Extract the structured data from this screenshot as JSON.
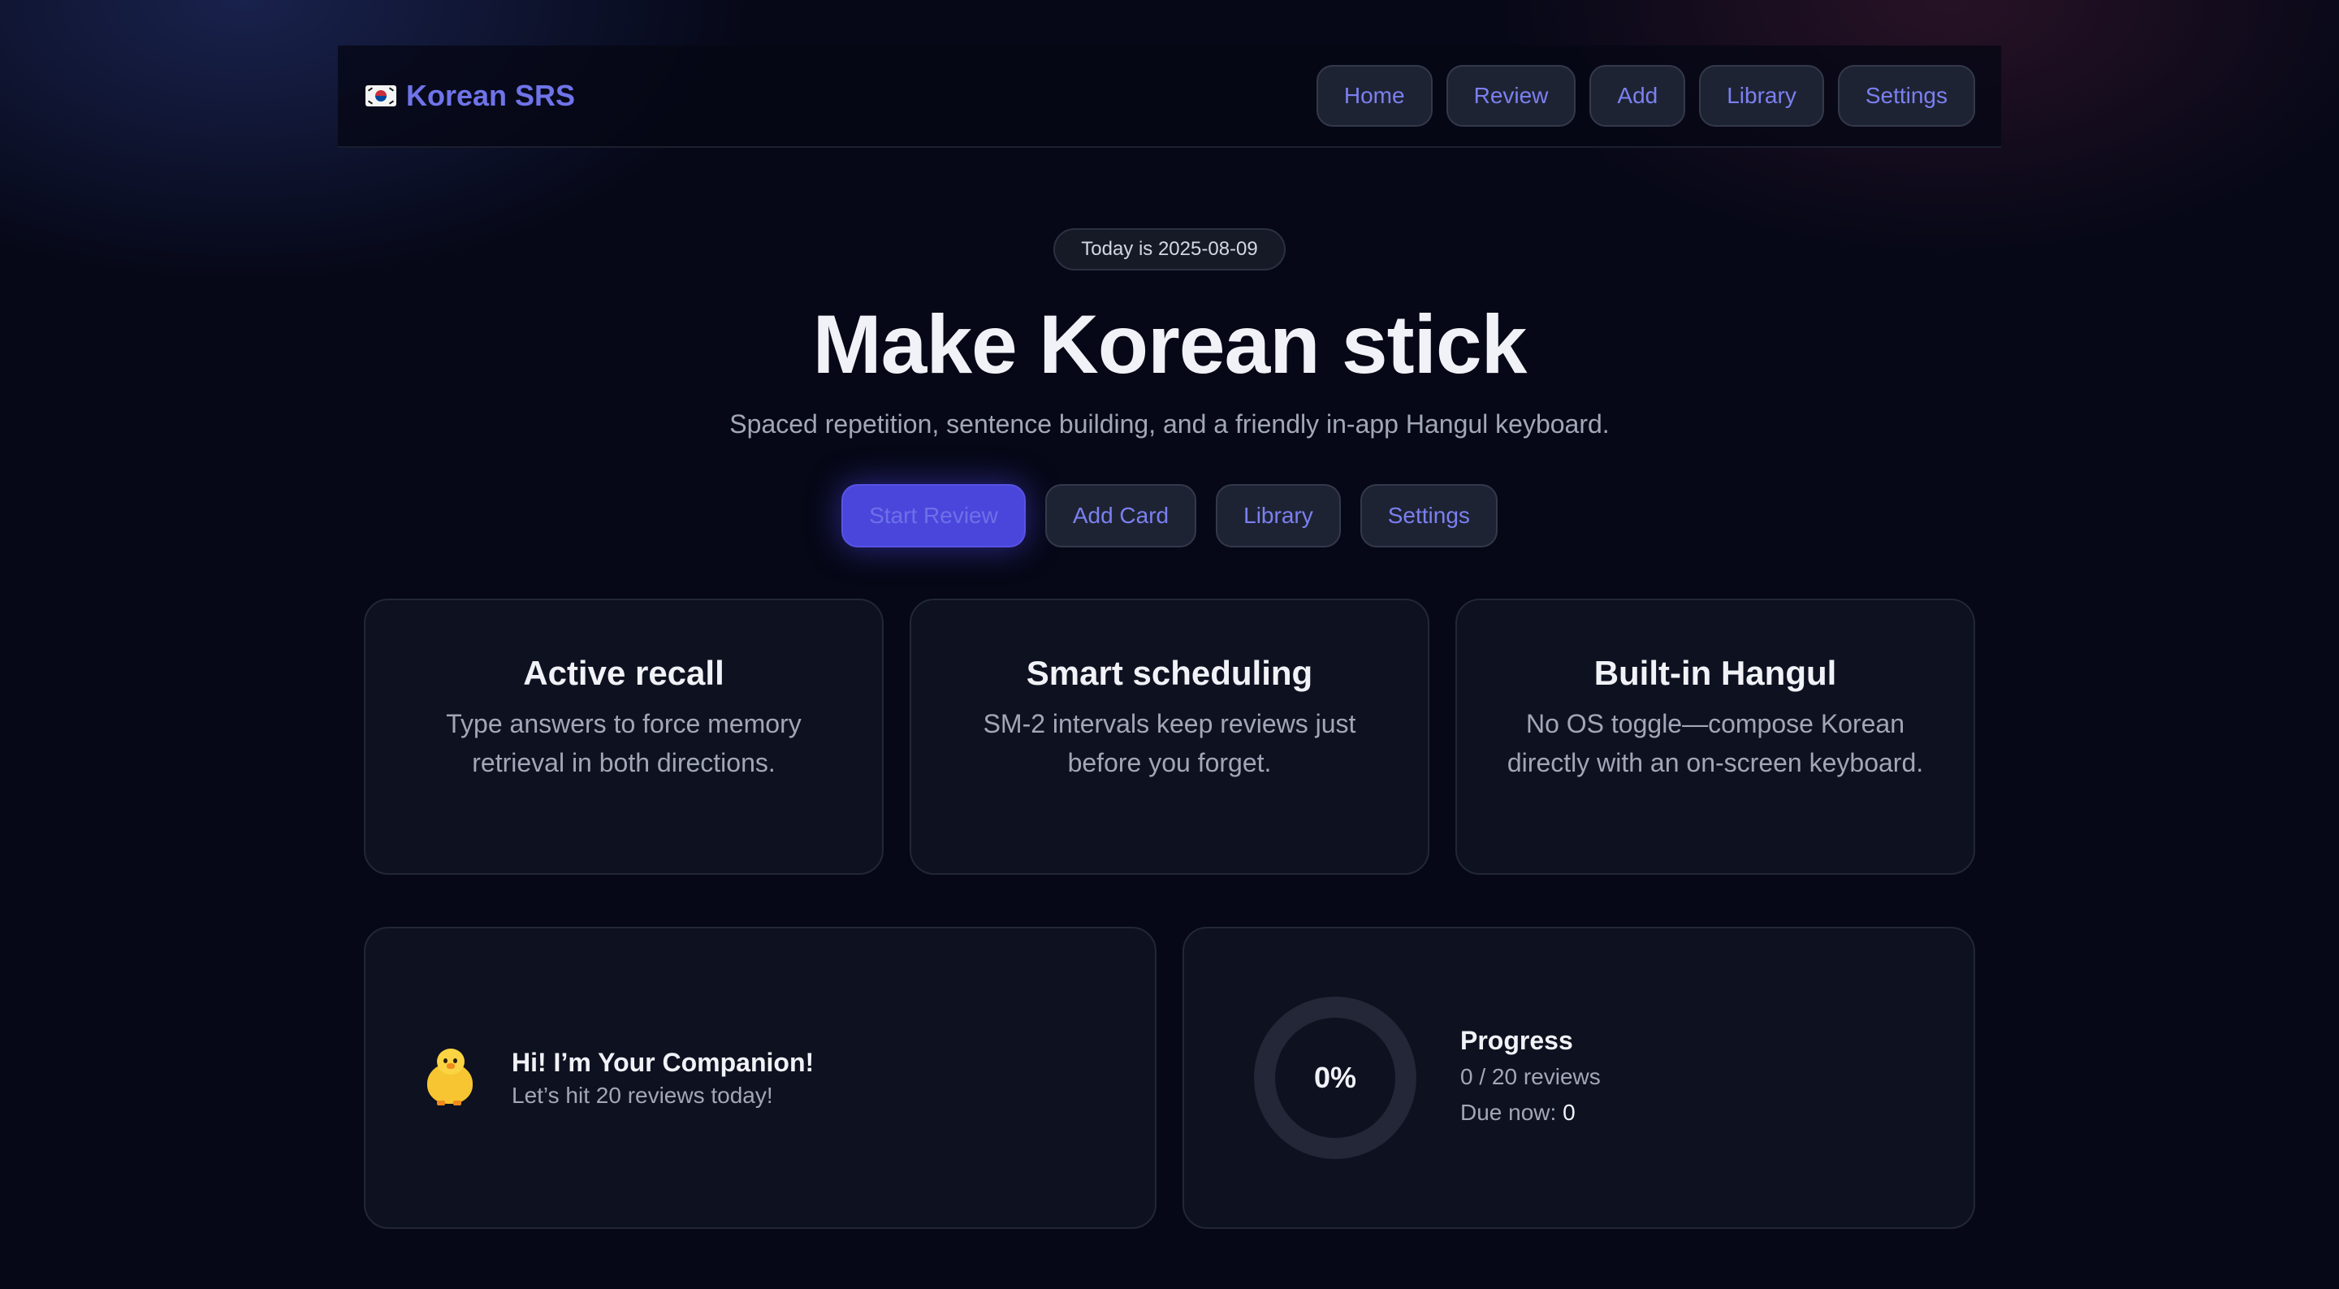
{
  "header": {
    "brand_flag_icon": "south-korea-flag-icon",
    "brand_name": "Korean SRS",
    "nav": [
      {
        "label": "Home"
      },
      {
        "label": "Review"
      },
      {
        "label": "Add"
      },
      {
        "label": "Library"
      },
      {
        "label": "Settings"
      }
    ]
  },
  "hero": {
    "date_badge": "Today is 2025-08-09",
    "title": "Make Korean stick",
    "subtitle": "Spaced repetition, sentence building, and a friendly in-app Hangul keyboard.",
    "actions": [
      {
        "label": "Start Review",
        "primary": true
      },
      {
        "label": "Add Card"
      },
      {
        "label": "Library"
      },
      {
        "label": "Settings"
      }
    ]
  },
  "features": [
    {
      "title": "Active recall",
      "text": "Type answers to force memory retrieval in both directions."
    },
    {
      "title": "Smart scheduling",
      "text": "SM-2 intervals keep reviews just before you forget."
    },
    {
      "title": "Built-in Hangul",
      "text": "No OS toggle—compose Korean directly with an on-screen keyboard."
    }
  ],
  "companion": {
    "icon": "chick-icon",
    "title": "Hi! I’m Your Companion!",
    "message": "Let’s hit 20 reviews today!"
  },
  "progress": {
    "percent_label": "0%",
    "percent_value": 0,
    "title": "Progress",
    "reviews": "0 / 20 reviews",
    "due_label": "Due now: ",
    "due_value": "0"
  },
  "colors": {
    "accent": "#4a46dc",
    "accent_text": "#7b80f0",
    "background": "#060817",
    "card": "#0e1120"
  }
}
